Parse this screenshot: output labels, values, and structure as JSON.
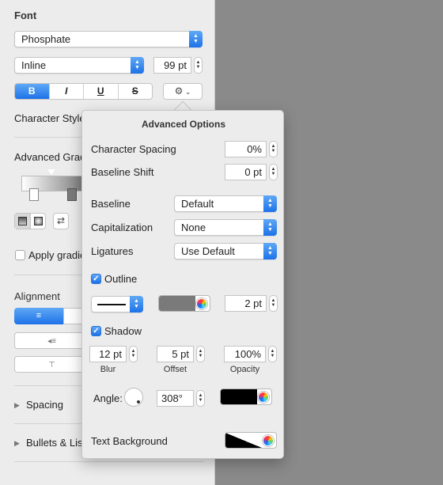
{
  "sidebar": {
    "font_heading": "Font",
    "font_family": "Phosphate",
    "font_style": "Inline",
    "font_size": "99 pt",
    "style_buttons": {
      "bold": "B",
      "italic": "I",
      "underline": "U",
      "strike": "S"
    },
    "character_styles_label": "Character Style",
    "advanced_gradient_label": "Advanced Grad",
    "apply_gradient_label": "Apply gradie",
    "alignment_heading": "Alignment",
    "spacing_label": "Spacing",
    "bullets_label": "Bullets & Lis",
    "accent_color": "#1d72e8"
  },
  "popover": {
    "title": "Advanced Options",
    "character_spacing": {
      "label": "Character Spacing",
      "value": "0%"
    },
    "baseline_shift": {
      "label": "Baseline Shift",
      "value": "0 pt"
    },
    "baseline": {
      "label": "Baseline",
      "value": "Default"
    },
    "capitalization": {
      "label": "Capitalization",
      "value": "None"
    },
    "ligatures": {
      "label": "Ligatures",
      "value": "Use Default"
    },
    "outline": {
      "label": "Outline",
      "checked": true,
      "width": "2 pt",
      "color": "#7a7a7a"
    },
    "shadow": {
      "label": "Shadow",
      "checked": true,
      "blur": {
        "label": "Blur",
        "value": "12 pt"
      },
      "offset": {
        "label": "Offset",
        "value": "5 pt"
      },
      "opacity": {
        "label": "Opacity",
        "value": "100%"
      },
      "angle_label": "Angle:",
      "angle_value": "308°",
      "color": "#000000"
    },
    "text_background": {
      "label": "Text Background"
    }
  }
}
